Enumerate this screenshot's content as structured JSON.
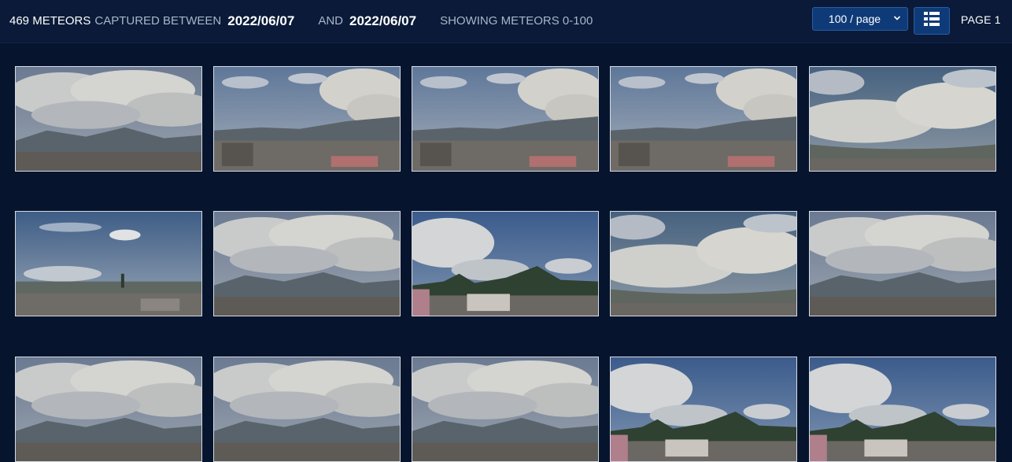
{
  "header": {
    "count": "469 METEORS",
    "captured_between": "CAPTURED BETWEEN",
    "date_start": "2022/06/07",
    "and": "AND",
    "date_end": "2022/06/07",
    "showing": "SHOWING METEORS 0-100",
    "per_page": "100 / page",
    "page": "PAGE 1",
    "list_icon": "list-view-icon",
    "chevron_icon": "chevron-down-icon"
  },
  "colors": {
    "background": "#06142e",
    "topbar": "#0a1a38",
    "button": "#0e3b78",
    "button_border": "#2a5da3"
  },
  "thumbnails": [
    {
      "variant": "overcast-wide"
    },
    {
      "variant": "town-left"
    },
    {
      "variant": "town-left"
    },
    {
      "variant": "town-left"
    },
    {
      "variant": "blue-patch"
    },
    {
      "variant": "blue-clear"
    },
    {
      "variant": "overcast-wide"
    },
    {
      "variant": "blue-trees"
    },
    {
      "variant": "blue-patch"
    },
    {
      "variant": "overcast-wide"
    },
    {
      "variant": "overcast-wide"
    },
    {
      "variant": "overcast-wide"
    },
    {
      "variant": "overcast-wide"
    },
    {
      "variant": "blue-trees"
    },
    {
      "variant": "blue-trees"
    }
  ]
}
